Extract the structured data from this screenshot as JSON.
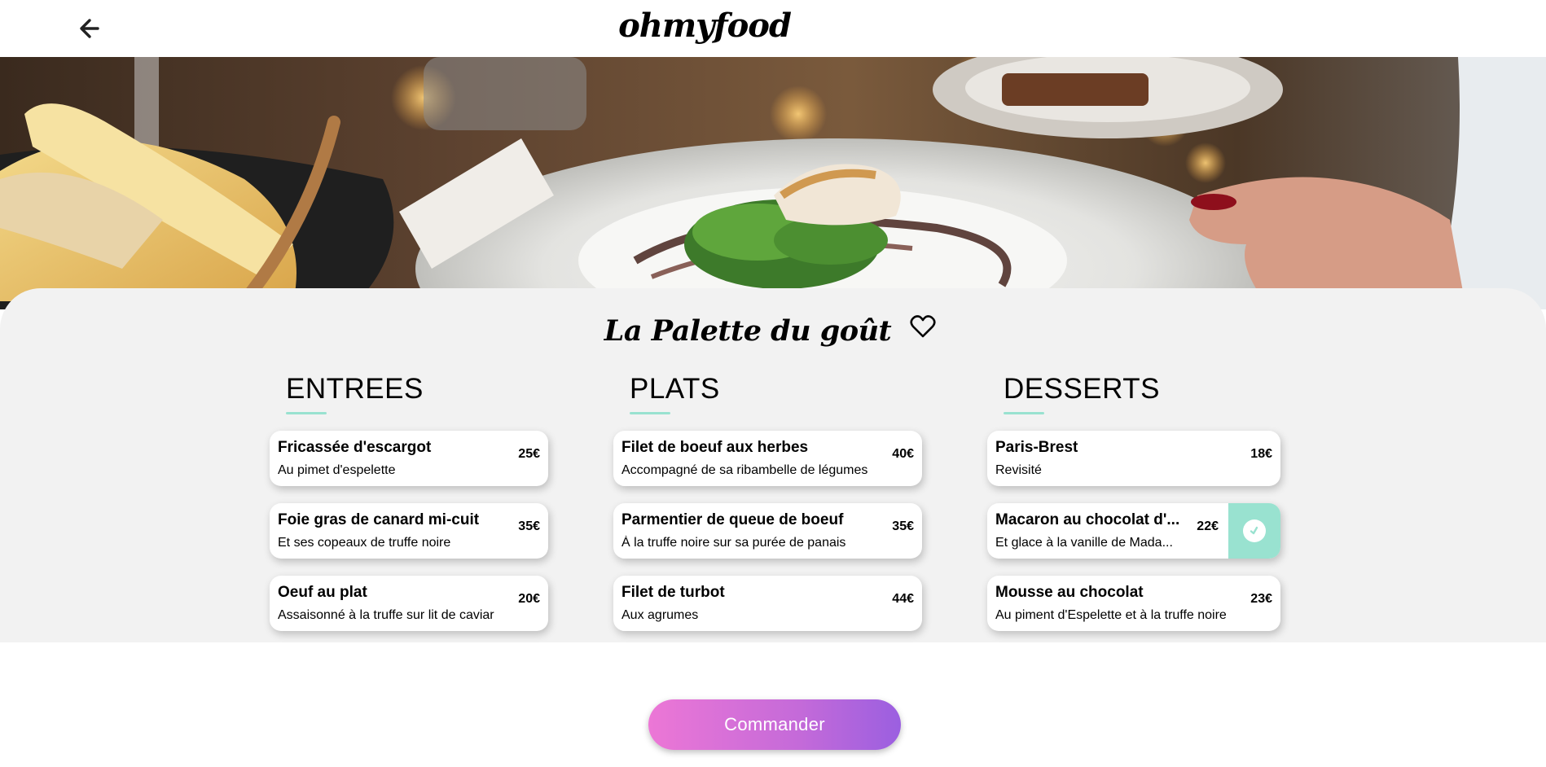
{
  "header": {
    "logo": "ohmyfood",
    "back_icon": "arrow-left-icon"
  },
  "hero": {
    "image": "restaurant-dish-photo"
  },
  "restaurant": {
    "name": "La Palette du goût",
    "favorite_icon": "heart-outline-icon"
  },
  "colors": {
    "accent": "#99e2d0",
    "panel_bg": "#f2f2f2",
    "button_gradient_start": "#ec77d6",
    "button_gradient_end": "#9b5fe0"
  },
  "menu": {
    "sections": [
      {
        "title": "ENTREES",
        "items": [
          {
            "name": "Fricassée d'escargot",
            "description": "Au pimet d'espelette",
            "price": "25€"
          },
          {
            "name": "Foie gras de canard mi-cuit",
            "description": "Et ses copeaux de truffe noire",
            "price": "35€"
          },
          {
            "name": "Oeuf au plat",
            "description": "Assaisonné à la truffe sur lit de caviar",
            "price": "20€"
          }
        ]
      },
      {
        "title": "PLATS",
        "items": [
          {
            "name": "Filet de boeuf aux herbes",
            "description": "Accompagné de sa ribambelle de légumes",
            "price": "40€"
          },
          {
            "name": "Parmentier de queue de boeuf",
            "description": "À la truffe noire sur sa purée de panais",
            "price": "35€"
          },
          {
            "name": "Filet de turbot",
            "description": "Aux agrumes",
            "price": "44€"
          }
        ]
      },
      {
        "title": "DESSERTS",
        "items": [
          {
            "name": "Paris-Brest",
            "description": "Revisité",
            "price": "18€"
          },
          {
            "name": "Macaron au chocolat d'...",
            "description": "Et glace à la vanille de Mada...",
            "price": "22€",
            "selected": true,
            "selected_icon": "check-icon"
          },
          {
            "name": "Mousse au chocolat",
            "description": "Au piment d'Espelette et à la truffe noire",
            "price": "23€"
          }
        ]
      }
    ]
  },
  "order_button": {
    "label": "Commander"
  }
}
